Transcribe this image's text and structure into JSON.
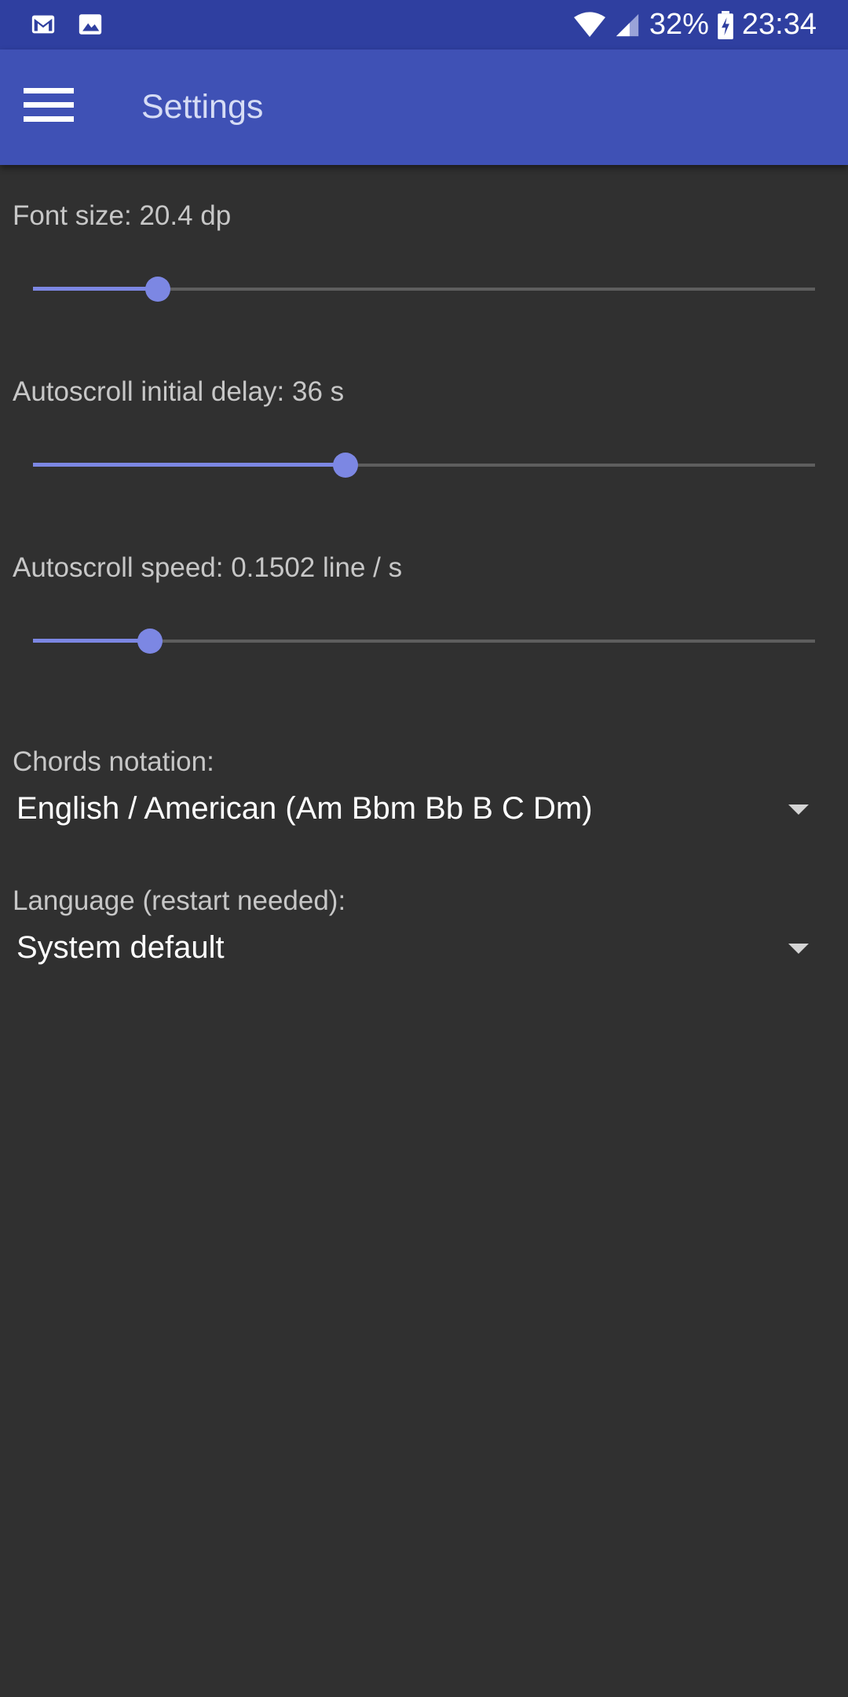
{
  "status_bar": {
    "battery": "32%",
    "time": "23:34",
    "icons": [
      "gmail-icon",
      "image-icon",
      "wifi-icon",
      "signal-icon",
      "battery-charging-icon"
    ]
  },
  "app_bar": {
    "title": "Settings",
    "menu_icon": "hamburger-menu-icon",
    "color": "#3f51b5"
  },
  "settings": {
    "font_size": {
      "label": "Font size: 20.4 dp",
      "level": 0.16
    },
    "autoscroll_delay": {
      "label": "Autoscroll initial delay: 36 s",
      "level": 0.4
    },
    "autoscroll_speed": {
      "label": "Autoscroll speed: 0.1502 line / s",
      "level": 0.15
    },
    "chords_notation": {
      "label": "Chords notation:",
      "value": "English / American (Am Bbm Bb B C Dm)"
    },
    "language": {
      "label": "Language (restart needed):",
      "value": "System default"
    }
  },
  "colors": {
    "background": "#303030",
    "accent": "#7c87e3",
    "status_bar": "#2f3fa0"
  }
}
